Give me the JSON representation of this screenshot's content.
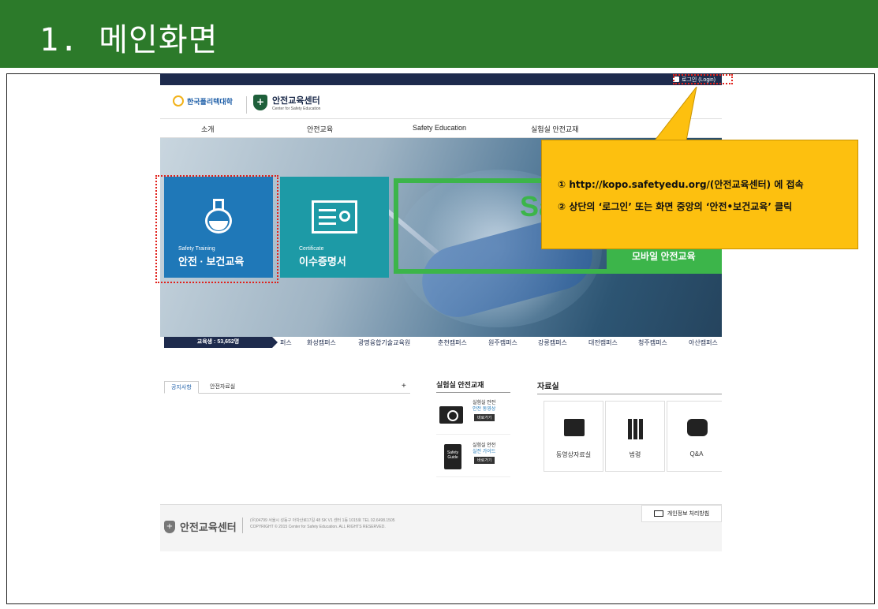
{
  "slide": {
    "title": "1. 메인화면"
  },
  "site": {
    "login_label": "로그인 (Login)",
    "kopo_name": "한국폴리텍대학",
    "center_name": "안전교육센터",
    "center_en": "Center for Safety Education",
    "nav": [
      "소개",
      "안전교육",
      "Safety Education",
      "실험실 안전교재"
    ],
    "tiles": {
      "safety": {
        "sub": "Safety Training",
        "main": "안전 · 보건교육"
      },
      "certificate": {
        "sub": "Certificate",
        "main": "이수증명서"
      }
    },
    "hero_sa": "Sa",
    "mobile_label": "모바일 안전교육",
    "student_count": "교육생 : 53,652명",
    "campuses": [
      "퍼스",
      "화성캠퍼스",
      "광명융합기술교육원",
      "춘천캠퍼스",
      "원주캠퍼스",
      "강릉캠퍼스",
      "대전캠퍼스",
      "청주캠퍼스",
      "아산캠퍼스"
    ],
    "notice_tabs": [
      "공지사항",
      "안전자료실"
    ],
    "notice_plus": "+",
    "lab_title": "실험실 안전교재",
    "lab_items": [
      {
        "line1": "실험실 안전",
        "line2": "안전 동영상",
        "go": "바로가기"
      },
      {
        "icon_text": "Safety Guide",
        "line1": "실험실 안전",
        "line2": "실전 가이드",
        "go": "바로가기"
      }
    ],
    "resource_title": "자료실",
    "resources": [
      "동영상자료실",
      "법령",
      "Q&A"
    ],
    "footer": {
      "name": "안전교육센터",
      "address": "(우)04799 서울시 성동구 아차산로17길 48 SK V1 센터 1동 1015호 TEL 02.6498.1505",
      "copyright": "COPYRIGHT © 2015 Center for Safety Education. ALL RIGHTS RESERVED.",
      "privacy": "개인정보 처리방침"
    }
  },
  "callout": {
    "line1": "① http://kopo.safetyedu.org/(안전교육센터) 에 접속",
    "line2": "② 상단의 ‘로그인’ 또는 화면 중앙의 ‘안전•보건교육’ 클릭"
  },
  "colors": {
    "header_green": "#2c7a2a",
    "callout_yellow": "#fdc00f",
    "highlight_red": "#e0211b",
    "tile_blue": "#1f78b8",
    "tile_teal": "#1d9aa6",
    "accent_green": "#3cb54a",
    "navy": "#1e2b4d"
  }
}
